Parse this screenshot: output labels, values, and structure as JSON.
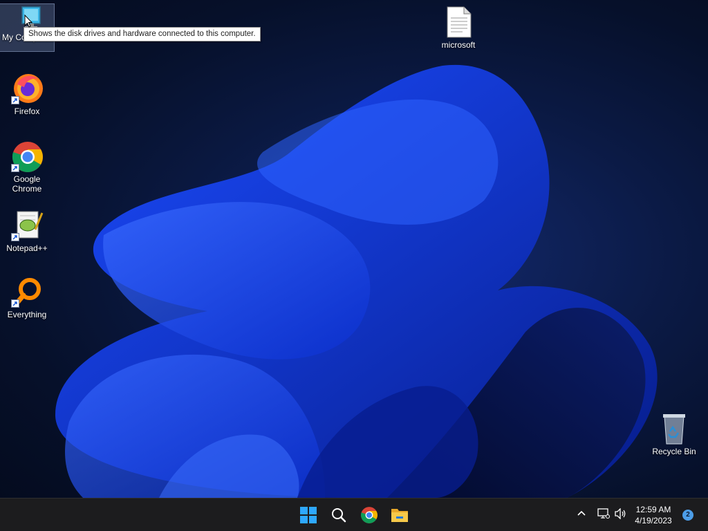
{
  "desktop": {
    "icons": [
      {
        "label": "My Computer",
        "icon": "computer-icon"
      },
      {
        "label": "Firefox",
        "icon": "firefox-icon"
      },
      {
        "label": "Google Chrome",
        "icon": "chrome-icon"
      },
      {
        "label": "Notepad++",
        "icon": "notepadpp-icon"
      },
      {
        "label": "Everything",
        "icon": "everything-icon"
      },
      {
        "label": "microsoft",
        "icon": "document-icon"
      },
      {
        "label": "Recycle Bin",
        "icon": "recycle-bin-icon"
      }
    ],
    "tooltip": "Shows the disk drives and hardware connected to this computer."
  },
  "taskbar": {
    "apps": [
      {
        "name": "Start",
        "icon": "windows-start-icon"
      },
      {
        "name": "Search",
        "icon": "search-icon"
      },
      {
        "name": "Google Chrome",
        "icon": "chrome-icon"
      },
      {
        "name": "File Explorer",
        "icon": "folder-icon"
      }
    ],
    "tray": {
      "time": "12:59 AM",
      "date": "4/19/2023",
      "notification_count": "2"
    }
  },
  "colors": {
    "accent": "#1f4fff",
    "taskbar": "#1c1c1e",
    "badge": "#4c9de8"
  }
}
